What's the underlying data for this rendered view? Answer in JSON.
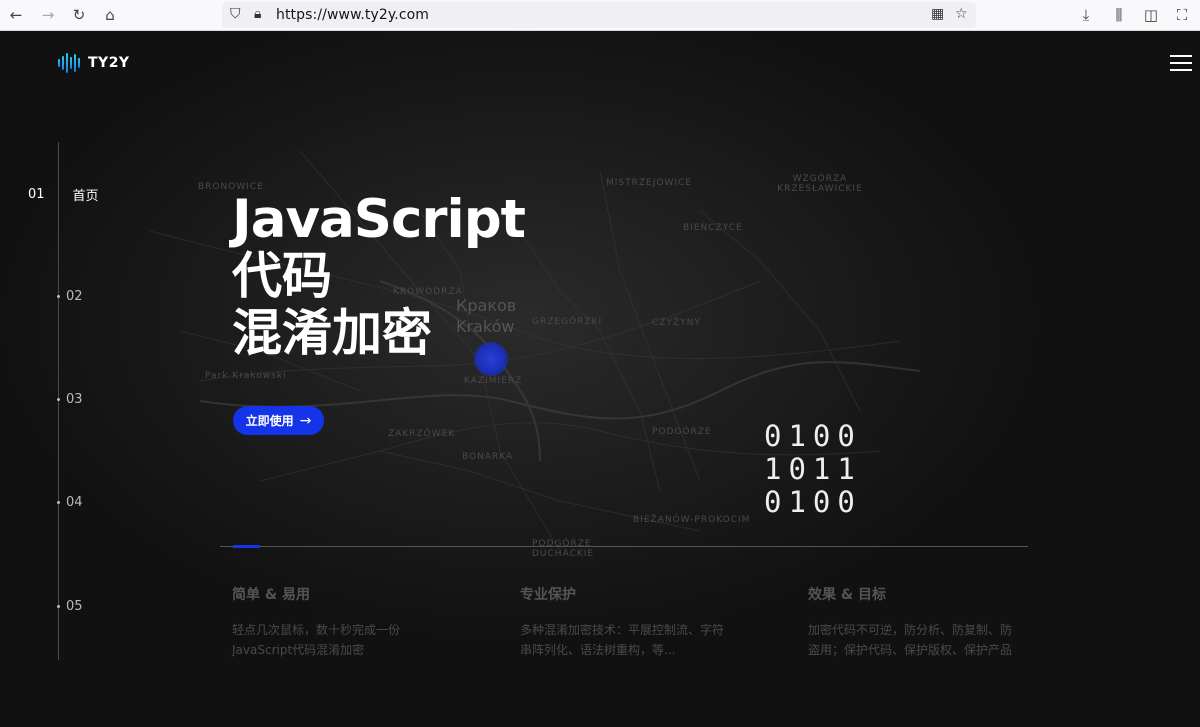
{
  "browser": {
    "url": "https://www.ty2y.com",
    "icons": [
      "back-icon",
      "forward-icon",
      "reload-icon",
      "home-icon",
      "shield-icon",
      "lock-icon",
      "qr-code-icon",
      "star-icon",
      "download-icon",
      "library-icon",
      "sidebar-icon",
      "screenshot-icon"
    ]
  },
  "header": {
    "logo_text": "TY2Y"
  },
  "side_nav": {
    "items": [
      {
        "num": "01",
        "label": "首页"
      },
      {
        "num": "02"
      },
      {
        "num": "03"
      },
      {
        "num": "04"
      },
      {
        "num": "05"
      }
    ]
  },
  "hero": {
    "title_line1": "JavaScript",
    "title_line2": "代码",
    "title_line3": "混淆加密",
    "cta_label": "立即使用",
    "binary": [
      "0100",
      "1011",
      "0100"
    ]
  },
  "map": {
    "labels": [
      "MISTRZEJOWICE",
      "WZGÓRZA KRZESŁAWICKIE",
      "BIEŃCZYCE",
      "KROWODRZA",
      "Краков",
      "Kraków",
      "CZYŻYNY",
      "GRZEGÓRZKI",
      "KAZIMIERZ",
      "PODGÓRZE",
      "ZAKRZÓWEK",
      "BONARKA",
      "BIEŻANÓW-PROKOCIM",
      "PODGÓRZE DUCHACKIE",
      "Park Krakowski",
      "BRONOWICE"
    ]
  },
  "features": [
    {
      "title": "简单 & 易用",
      "desc": "轻点几次鼠标，数十秒完成一份JavaScript代码混淆加密"
    },
    {
      "title": "专业保护",
      "desc": "多种混淆加密技术：平展控制流、字符串阵列化、语法树重构，等..."
    },
    {
      "title": "效果 & 目标",
      "desc": "加密代码不可逆，防分析、防复制、防盗用；保护代码、保护版权、保护产品"
    }
  ],
  "colors": {
    "accent": "#1533e8",
    "logo_gradient_top": "#28d1e6",
    "logo_gradient_bottom": "#1a7be8"
  }
}
